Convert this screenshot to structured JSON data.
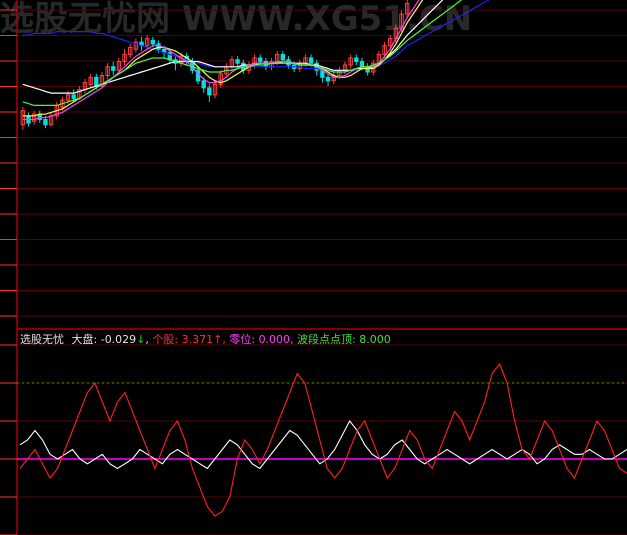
{
  "watermark": "选股无忧网 WWW.XG51.CN",
  "indicator": {
    "name": "选股无忧",
    "dapan_label": "大盘:",
    "dapan_value": "-0.029",
    "dapan_arrow": "↓",
    "gegu_label": "个股:",
    "gegu_value": "3.371",
    "gegu_arrow": "↑",
    "lingwei_label": "零位:",
    "lingwei_value": "0.000",
    "boduan_label": "波段点点顶:",
    "boduan_value": "8.000"
  },
  "colors": {
    "background": "#000000",
    "frame": "#b00000",
    "grid": "#5a0000",
    "up": "#ff4040",
    "down": "#00e0e0",
    "dapan_line": "#ffffff",
    "gegu_line": "#ff2020",
    "zero_line": "#ff00ff",
    "top_line": "#00c000",
    "ma_blue": "#2020ff",
    "ma_white": "#ffffff",
    "ma_yellow": "#ffff40",
    "ma_magenta": "#ff40ff",
    "ma_green": "#40ff40"
  },
  "chart_data": [
    {
      "type": "candlestick",
      "title": "",
      "note": "Price panel: candlesticks with moving-average lines; axis tick labels are cut off at the left edge.",
      "candles": [
        [
          27,
          35,
          24,
          37
        ],
        [
          32,
          28,
          26,
          34
        ],
        [
          29,
          33,
          27,
          35
        ],
        [
          33,
          30,
          28,
          35
        ],
        [
          30,
          27,
          25,
          32
        ],
        [
          27,
          32,
          26,
          34
        ],
        [
          32,
          38,
          30,
          40
        ],
        [
          37,
          41,
          35,
          43
        ],
        [
          41,
          44,
          39,
          46
        ],
        [
          44,
          42,
          40,
          47
        ],
        [
          42,
          47,
          41,
          49
        ],
        [
          47,
          51,
          45,
          53
        ],
        [
          50,
          54,
          48,
          56
        ],
        [
          54,
          49,
          47,
          56
        ],
        [
          49,
          55,
          48,
          57
        ],
        [
          55,
          60,
          53,
          62
        ],
        [
          60,
          58,
          55,
          63
        ],
        [
          58,
          63,
          56,
          65
        ],
        [
          63,
          67,
          61,
          70
        ],
        [
          67,
          71,
          65,
          73
        ],
        [
          70,
          74,
          68,
          76
        ],
        [
          74,
          72,
          69,
          77
        ],
        [
          72,
          76,
          70,
          78
        ],
        [
          75,
          73,
          71,
          77
        ],
        [
          73,
          70,
          68,
          75
        ],
        [
          70,
          68,
          65,
          72
        ],
        [
          68,
          64,
          62,
          70
        ],
        [
          64,
          62,
          58,
          66
        ],
        [
          62,
          66,
          60,
          68
        ],
        [
          66,
          63,
          61,
          68
        ],
        [
          63,
          58,
          56,
          65
        ],
        [
          58,
          52,
          50,
          60
        ],
        [
          52,
          48,
          45,
          54
        ],
        [
          48,
          44,
          40,
          50
        ],
        [
          44,
          50,
          42,
          52
        ],
        [
          50,
          56,
          48,
          58
        ],
        [
          56,
          60,
          54,
          62
        ],
        [
          60,
          64,
          58,
          66
        ],
        [
          64,
          62,
          60,
          66
        ],
        [
          62,
          58,
          56,
          64
        ],
        [
          58,
          61,
          56,
          63
        ],
        [
          61,
          65,
          59,
          67
        ],
        [
          65,
          63,
          61,
          67
        ],
        [
          63,
          60,
          58,
          65
        ],
        [
          60,
          63,
          58,
          65
        ],
        [
          63,
          67,
          61,
          69
        ],
        [
          67,
          64,
          62,
          69
        ],
        [
          64,
          61,
          59,
          66
        ],
        [
          61,
          59,
          57,
          63
        ],
        [
          59,
          62,
          57,
          64
        ],
        [
          62,
          65,
          60,
          67
        ],
        [
          65,
          62,
          60,
          67
        ],
        [
          62,
          58,
          55,
          64
        ],
        [
          58,
          54,
          51,
          60
        ],
        [
          54,
          52,
          49,
          56
        ],
        [
          52,
          55,
          50,
          57
        ],
        [
          55,
          58,
          53,
          60
        ],
        [
          58,
          61,
          56,
          63
        ],
        [
          61,
          65,
          59,
          67
        ],
        [
          65,
          63,
          61,
          67
        ],
        [
          63,
          60,
          58,
          65
        ],
        [
          60,
          57,
          55,
          62
        ],
        [
          57,
          62,
          55,
          64
        ],
        [
          62,
          67,
          60,
          69
        ],
        [
          67,
          72,
          65,
          74
        ],
        [
          72,
          76,
          70,
          78
        ],
        [
          76,
          82,
          74,
          84
        ],
        [
          82,
          90,
          80,
          92
        ],
        [
          90,
          96,
          88,
          98
        ]
      ],
      "ma_series": [
        {
          "color_key": "ma_blue",
          "values": [
            78,
            78,
            79,
            79,
            79,
            79,
            80,
            80,
            80,
            80,
            80,
            80,
            80,
            79,
            79,
            78,
            77,
            76,
            75,
            74,
            73,
            72,
            71,
            70,
            69,
            68,
            67,
            66,
            65,
            64,
            63,
            62,
            61,
            60,
            60,
            60,
            60,
            60,
            60,
            60,
            60,
            60,
            60,
            60,
            60,
            60,
            60,
            60,
            60,
            60,
            59,
            59,
            59,
            58,
            58,
            58,
            58,
            58,
            58,
            58,
            59,
            59,
            60,
            61,
            62,
            64,
            66,
            69,
            72
          ]
        },
        {
          "color_key": "ma_white",
          "values": [
            50,
            49,
            48,
            47,
            46,
            45,
            45,
            45,
            45,
            45,
            46,
            47,
            48,
            49,
            50,
            51,
            52,
            53,
            54,
            55,
            56,
            57,
            58,
            59,
            60,
            61,
            62,
            63,
            63,
            63,
            63,
            63,
            62,
            61,
            60,
            60,
            60,
            60,
            60,
            61,
            61,
            62,
            62,
            62,
            62,
            62,
            62,
            62,
            62,
            62,
            62,
            61,
            61,
            60,
            59,
            58,
            58,
            58,
            58,
            59,
            59,
            59,
            60,
            62,
            64,
            67,
            70,
            74,
            78
          ]
        },
        {
          "color_key": "ma_yellow",
          "values": [
            32,
            32,
            32,
            33,
            33,
            34,
            35,
            36,
            38,
            40,
            42,
            44,
            46,
            48,
            50,
            52,
            54,
            56,
            58,
            61,
            64,
            66,
            68,
            70,
            71,
            71,
            70,
            69,
            67,
            65,
            63,
            60,
            57,
            54,
            52,
            51,
            52,
            54,
            56,
            58,
            60,
            61,
            62,
            62,
            62,
            62,
            63,
            63,
            62,
            61,
            61,
            61,
            60,
            59,
            57,
            55,
            54,
            54,
            55,
            57,
            59,
            59,
            59,
            61,
            64,
            68,
            73,
            79,
            85
          ]
        },
        {
          "color_key": "ma_magenta",
          "values": [
            30,
            30,
            30,
            31,
            31,
            32,
            33,
            34,
            36,
            38,
            40,
            42,
            44,
            46,
            48,
            51,
            54,
            57,
            60,
            63,
            66,
            68,
            70,
            72,
            72,
            71,
            69,
            67,
            65,
            63,
            60,
            56,
            53,
            51,
            51,
            52,
            54,
            57,
            59,
            60,
            61,
            62,
            62,
            62,
            62,
            63,
            63,
            63,
            62,
            61,
            61,
            61,
            60,
            58,
            56,
            54,
            54,
            55,
            57,
            59,
            60,
            60,
            60,
            62,
            66,
            70,
            76,
            82,
            88
          ]
        },
        {
          "color_key": "ma_green",
          "values": [
            40,
            39,
            38,
            38,
            38,
            38,
            38,
            39,
            40,
            41,
            42,
            44,
            46,
            48,
            50,
            52,
            54,
            56,
            58,
            60,
            62,
            63,
            64,
            65,
            65,
            65,
            64,
            63,
            62,
            61,
            60,
            59,
            58,
            57,
            57,
            57,
            58,
            58,
            59,
            60,
            60,
            61,
            61,
            61,
            62,
            62,
            62,
            62,
            62,
            61,
            61,
            61,
            60,
            59,
            58,
            57,
            57,
            57,
            58,
            59,
            60,
            60,
            61,
            62,
            64,
            66,
            69,
            72,
            75
          ]
        }
      ]
    },
    {
      "type": "line",
      "title": "选股无忧",
      "note": "Oscillator panel; zero line (零位 0.000) and top line (波段点点顶 8.000).",
      "ylim": [
        -8,
        12
      ],
      "zero": 0,
      "top": 8,
      "series": [
        {
          "name": "大盘",
          "color_key": "dapan_line",
          "values": [
            1.5,
            2.0,
            3.0,
            2.0,
            0.5,
            0.0,
            0.5,
            1.0,
            0.0,
            -0.5,
            0.0,
            0.5,
            -0.5,
            -1.0,
            -0.5,
            0.0,
            1.0,
            0.5,
            0.0,
            -0.5,
            0.5,
            1.0,
            0.5,
            0.0,
            -0.5,
            -1.0,
            0.0,
            1.0,
            2.0,
            1.5,
            0.5,
            -0.5,
            -1.0,
            0.0,
            1.0,
            2.0,
            3.0,
            2.5,
            1.5,
            0.5,
            -0.5,
            0.0,
            1.0,
            2.5,
            4.0,
            3.0,
            1.5,
            0.5,
            0.0,
            0.5,
            1.5,
            2.0,
            1.0,
            0.0,
            -0.5,
            0.0,
            0.5,
            1.0,
            0.5,
            0.0,
            -0.5,
            0.0,
            0.5,
            1.0,
            0.5,
            0.0,
            0.5,
            1.0,
            0.5,
            -0.5,
            0.0,
            1.0,
            1.5,
            1.0,
            0.5,
            0.5,
            1.0,
            0.5,
            0.0,
            0.0,
            0.5,
            1.0
          ]
        },
        {
          "name": "个股",
          "color_key": "gegu_line",
          "values": [
            -1.0,
            0.0,
            1.0,
            -0.5,
            -2.0,
            -1.0,
            1.0,
            3.0,
            5.0,
            7.0,
            8.0,
            6.0,
            4.0,
            6.0,
            7.0,
            5.0,
            3.0,
            1.0,
            -1.0,
            1.0,
            3.0,
            4.0,
            2.0,
            -1.0,
            -3.0,
            -5.0,
            -6.0,
            -5.5,
            -4.0,
            0.0,
            2.0,
            1.0,
            -0.5,
            1.0,
            3.0,
            5.0,
            7.0,
            9.0,
            8.0,
            5.0,
            2.0,
            -1.0,
            -2.0,
            -1.0,
            1.0,
            3.0,
            4.0,
            2.0,
            0.0,
            -2.0,
            -1.0,
            1.0,
            3.0,
            2.0,
            0.0,
            -1.0,
            1.0,
            3.0,
            5.0,
            4.0,
            2.0,
            4.0,
            6.0,
            9.0,
            10.0,
            8.0,
            4.0,
            1.0,
            0.0,
            2.0,
            4.0,
            3.0,
            1.0,
            -1.0,
            -2.0,
            0.0,
            2.0,
            4.0,
            3.0,
            1.0,
            -1.0,
            -1.5
          ]
        }
      ]
    }
  ]
}
